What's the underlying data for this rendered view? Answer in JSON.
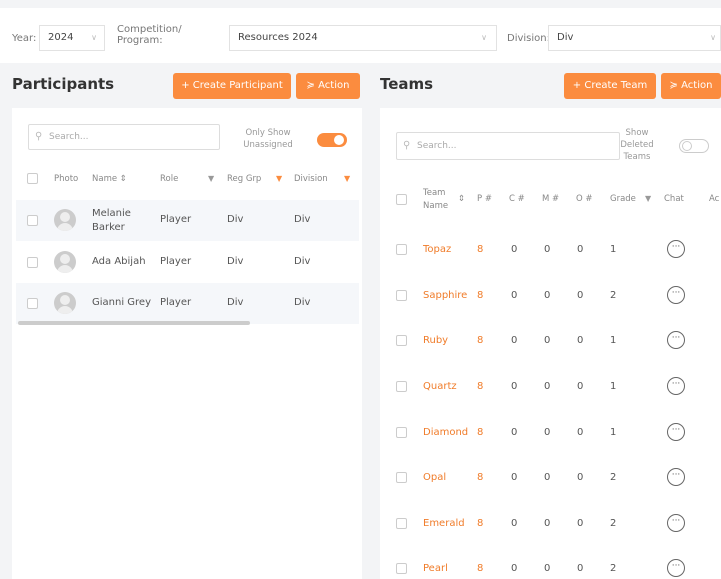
{
  "filters": {
    "year_label": "Year:",
    "year_value": "2024",
    "competition_label_line1": "Competition/",
    "competition_label_line2": "Program:",
    "competition_value": "Resources 2024",
    "division_label": "Division:",
    "division_value": "Div"
  },
  "participants": {
    "title": "Participants",
    "create_button": "+ Create Participant",
    "action_button": "≽ Action",
    "search_placeholder": "Search...",
    "toggle_label_line1": "Only Show",
    "toggle_label_line2": "Unassigned",
    "toggle_on": true,
    "headers": {
      "photo": "Photo",
      "name": "Name",
      "role": "Role",
      "reg_grp": "Reg Grp",
      "division": "Division"
    },
    "rows": [
      {
        "name_line1": "Melanie",
        "name_line2": "Barker",
        "role": "Player",
        "reg_grp": "Div",
        "division": "Div"
      },
      {
        "name_line1": "Ada Abijah",
        "name_line2": "",
        "role": "Player",
        "reg_grp": "Div",
        "division": "Div"
      },
      {
        "name_line1": "Gianni Grey",
        "name_line2": "",
        "role": "Player",
        "reg_grp": "Div",
        "division": "Div"
      }
    ]
  },
  "teams": {
    "title": "Teams",
    "create_button": "+ Create Team",
    "action_button": "≽ Action",
    "search_placeholder": "Search...",
    "toggle_label_line1": "Show",
    "toggle_label_line2": "Deleted",
    "toggle_label_line3": "Teams",
    "toggle_on": false,
    "headers": {
      "team_line1": "Team",
      "team_line2": "Name",
      "p": "P #",
      "c": "C #",
      "m": "M #",
      "o": "O #",
      "grade": "Grade",
      "chat": "Chat",
      "actions": "Ac"
    },
    "rows": [
      {
        "name": "Topaz",
        "p": "8",
        "c": "0",
        "m": "0",
        "o": "0",
        "grade": "1"
      },
      {
        "name": "Sapphire",
        "p": "8",
        "c": "0",
        "m": "0",
        "o": "0",
        "grade": "2"
      },
      {
        "name": "Ruby",
        "p": "8",
        "c": "0",
        "m": "0",
        "o": "0",
        "grade": "1"
      },
      {
        "name": "Quartz",
        "p": "8",
        "c": "0",
        "m": "0",
        "o": "0",
        "grade": "1"
      },
      {
        "name": "Diamond",
        "p": "8",
        "c": "0",
        "m": "0",
        "o": "0",
        "grade": "1"
      },
      {
        "name": "Opal",
        "p": "8",
        "c": "0",
        "m": "0",
        "o": "0",
        "grade": "2"
      },
      {
        "name": "Emerald",
        "p": "8",
        "c": "0",
        "m": "0",
        "o": "0",
        "grade": "2"
      },
      {
        "name": "Pearl",
        "p": "8",
        "c": "0",
        "m": "0",
        "o": "0",
        "grade": "2"
      }
    ]
  },
  "icons": {
    "search": "search-icon",
    "chat": "chat-bubble-icon",
    "filter": "filter-icon",
    "sort": "sort-icon",
    "chevron": "chevron-down-icon",
    "avatar": "avatar-placeholder-icon"
  },
  "colors": {
    "accent": "#fb8c3f",
    "team_name": "#f07c2a"
  }
}
